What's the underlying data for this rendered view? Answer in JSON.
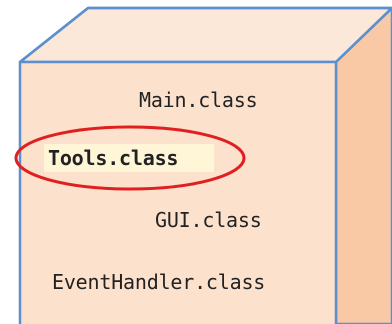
{
  "colors": {
    "face_front": "#fce1cd",
    "face_top": "#fce8d9",
    "face_side": "#f9c9a6",
    "edge": "#5b8fcf",
    "highlight_bg": "#fff6d8",
    "circle": "#e02020",
    "text": "#222222"
  },
  "files": [
    {
      "label": "Main.class"
    },
    {
      "label": "Tools.class"
    },
    {
      "label": "GUI.class"
    },
    {
      "label": "EventHandler.class"
    }
  ],
  "highlighted_file": "Tools.class"
}
